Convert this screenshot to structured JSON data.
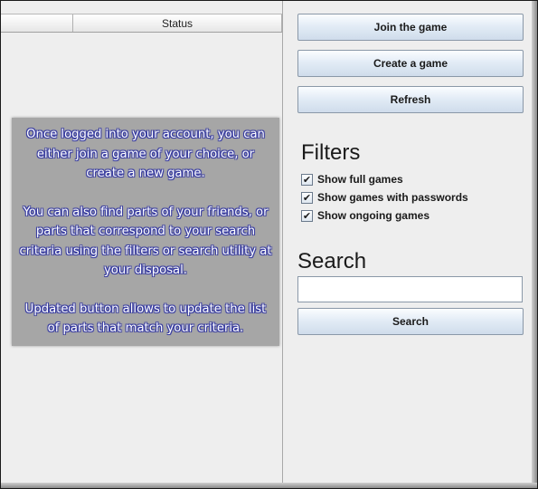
{
  "table": {
    "columns": [
      "",
      "Status"
    ]
  },
  "tutorial": {
    "paragraphs": [
      "Once logged into your account, you can\neither join a game of your choice, or\ncreate a new game.",
      "You can also find parts of your friends, or\nparts that correspond to your search\ncriteria using the filters or search utility at\nyour disposal.",
      "Updated button allows to update the list\nof parts that match your criteria."
    ]
  },
  "actions": {
    "join_label": "Join the game",
    "create_label": "Create a game",
    "refresh_label": "Refresh"
  },
  "filters": {
    "title": "Filters",
    "options": [
      {
        "label": "Show full games",
        "checked": true
      },
      {
        "label": "Show games with passwords",
        "checked": true
      },
      {
        "label": "Show ongoing games",
        "checked": true
      }
    ]
  },
  "search": {
    "title": "Search",
    "value": "",
    "button_label": "Search"
  },
  "icons": {
    "check": "check-mark"
  },
  "colors": {
    "overlay_bg": "#a6a6a6",
    "overlay_text_outline": "#3b3fa3",
    "button_gradient_top": "#fbfdff",
    "button_gradient_bottom": "#cfdceb"
  }
}
